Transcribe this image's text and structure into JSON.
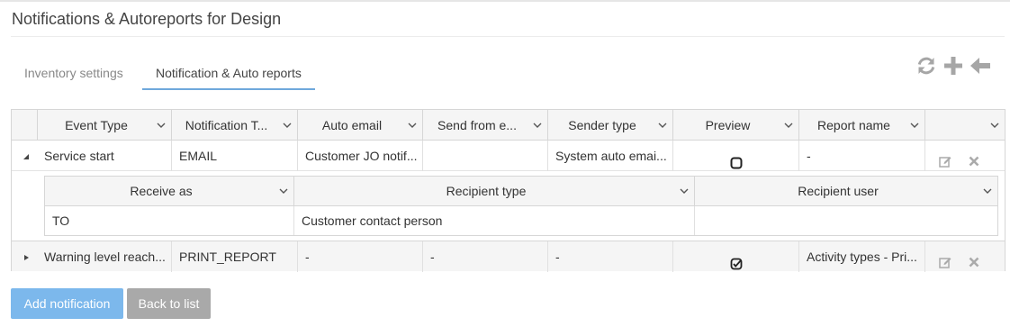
{
  "page": {
    "title": "Notifications & Autoreports for Design"
  },
  "tabs": [
    {
      "label": "Inventory settings",
      "active": false
    },
    {
      "label": "Notification & Auto reports",
      "active": true
    }
  ],
  "toolbar": {
    "icons": [
      "refresh-icon",
      "plus-icon",
      "arrow-left-icon"
    ]
  },
  "grid": {
    "columns": [
      "Event Type",
      "Notification T...",
      "Auto email",
      "Send from e...",
      "Sender type",
      "Preview",
      "Report name",
      ""
    ],
    "rows": [
      {
        "expanded": true,
        "event_type": "Service start",
        "notification_type": "EMAIL",
        "auto_email": "Customer JO notif...",
        "send_from": "",
        "sender_type": "System auto emai...",
        "preview_checked": false,
        "report_name": "-",
        "actions": [
          "edit-icon",
          "delete-icon"
        ]
      },
      {
        "expanded": false,
        "event_type": "Warning level reach...",
        "notification_type": "PRINT_REPORT",
        "auto_email": "-",
        "send_from": "-",
        "sender_type": "-",
        "preview_checked": true,
        "report_name": "Activity types - Pri...",
        "actions": [
          "edit-icon",
          "delete-icon"
        ]
      }
    ],
    "subgrid": {
      "columns": [
        "Receive as",
        "Recipient type",
        "Recipient user"
      ],
      "rows": [
        {
          "receive_as": "TO",
          "recipient_type": "Customer contact person",
          "recipient_user": ""
        }
      ]
    }
  },
  "buttons": {
    "add_label": "Add notification",
    "back_label": "Back to list"
  },
  "colors": {
    "accent": "#6fa8dc",
    "primary_button": "#7cb8ec",
    "secondary_button": "#a9a9a9",
    "header_bg": "#f5f5f5",
    "border": "#d6d6d6"
  }
}
